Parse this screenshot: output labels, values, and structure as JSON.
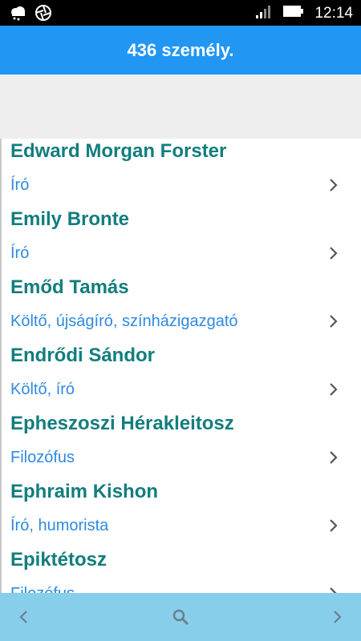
{
  "status_bar": {
    "time": "12:14",
    "icons": [
      "weather-cloud-icon",
      "aperture-icon",
      "signal-icon",
      "battery-icon"
    ]
  },
  "header": {
    "title": "436 személy."
  },
  "people": [
    {
      "name": "Edward Morgan Forster",
      "role": "Író"
    },
    {
      "name": "Emily Bronte",
      "role": "Író"
    },
    {
      "name": "Emőd Tamás",
      "role": "Költő, újságíró, színházigazgató"
    },
    {
      "name": "Endrődi Sándor",
      "role": "Költő, író"
    },
    {
      "name": "Epheszoszi Hérakleitosz",
      "role": "Filozófus"
    },
    {
      "name": "Ephraim Kishon",
      "role": "Író, humorista"
    },
    {
      "name": "Epiktétosz",
      "role": "Filozófus"
    }
  ],
  "bottom_bar": {
    "icons": [
      "chevron-left-icon",
      "search-icon",
      "chevron-right-icon"
    ]
  },
  "colors": {
    "header_bg": "#2196f3",
    "name_text": "#137d7d",
    "role_text": "#2f8ae0",
    "bottom_bar_bg": "#87ceeb"
  }
}
